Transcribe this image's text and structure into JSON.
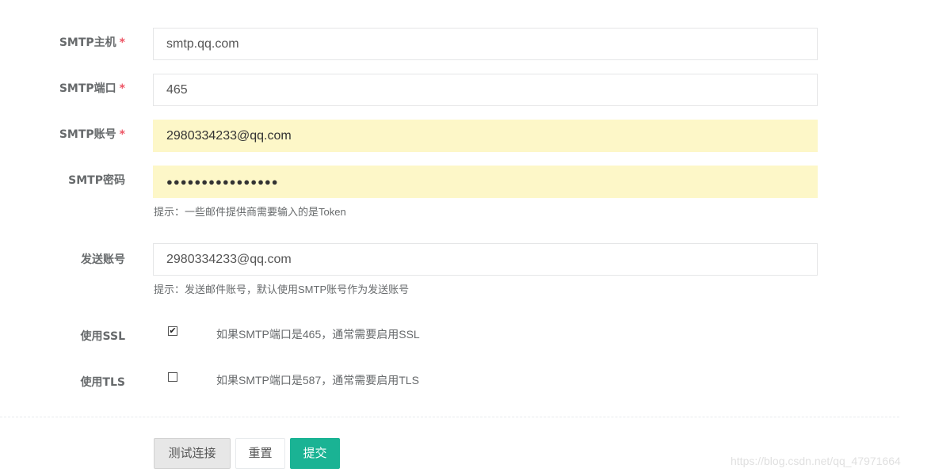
{
  "form": {
    "host": {
      "label": "SMTP主机",
      "required_mark": "*",
      "value": "smtp.qq.com"
    },
    "port": {
      "label": "SMTP端口",
      "required_mark": "*",
      "value": "465"
    },
    "account": {
      "label": "SMTP账号",
      "required_mark": "*",
      "value": "2980334233@qq.com"
    },
    "password": {
      "label": "SMTP密码",
      "value": "●●●●●●●●●●●●●●●●",
      "hint": "提示：一些邮件提供商需要输入的是Token"
    },
    "sender": {
      "label": "发送账号",
      "value": "2980334233@qq.com",
      "hint": "提示：发送邮件账号，默认使用SMTP账号作为发送账号"
    },
    "ssl": {
      "label": "使用SSL",
      "checked": true,
      "check_mark": "✔",
      "hint": "如果SMTP端口是465，通常需要启用SSL"
    },
    "tls": {
      "label": "使用TLS",
      "checked": false,
      "hint": "如果SMTP端口是587，通常需要启用TLS"
    }
  },
  "buttons": {
    "test": "测试连接",
    "reset": "重置",
    "submit": "提交"
  },
  "watermark": "https://blog.csdn.net/qq_47971664",
  "colors": {
    "primary": "#1ab394",
    "required": "#ed5565",
    "autofill": "#fdf7c8"
  }
}
